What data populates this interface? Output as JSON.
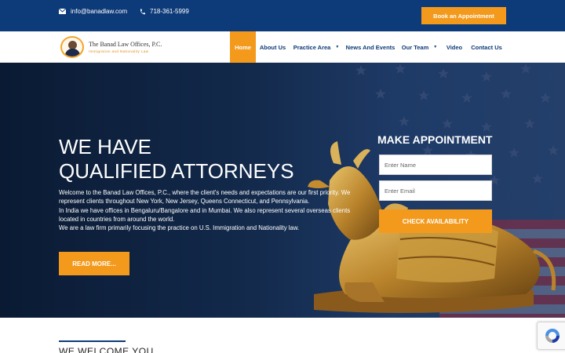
{
  "topbar": {
    "email": "info@banadlaw.com",
    "phone": "718-361-5999",
    "book_label": "Book an Appointment",
    "email_icon": "envelope-icon",
    "phone_icon": "phone-icon"
  },
  "logo": {
    "title": "The Banad Law Offices, P.C.",
    "subtitle": "Immigration and Nationality Law"
  },
  "nav": {
    "items": [
      {
        "label": "Home",
        "active": true
      },
      {
        "label": "About Us"
      },
      {
        "label": "Practice Area",
        "dropdown": true
      },
      {
        "label": "News And Events"
      },
      {
        "label": "Our Team",
        "dropdown": true
      },
      {
        "label": "Video"
      },
      {
        "label": "Contact Us"
      }
    ]
  },
  "hero": {
    "title_line1": "WE HAVE",
    "title_line2": "QUALIFIED ATTORNEYS",
    "para1": "Welcome to the Banad Law Offices, P.C., where the client's needs and expectations are our first priority. We represent clients throughout New York, New Jersey, Queens Connecticut, and Pennsylvania.",
    "para2": "In India we have offices in Bengaluru/Bangalore and in Mumbai. We also represent several overseas clients located in countries from around the world.",
    "para3": "We are a law firm primarily focusing the practice on U.S. Immigration and Nationality law.",
    "read_more_label": "READ MORE..."
  },
  "appointment": {
    "title": "MAKE APPOINTMENT",
    "name_placeholder": "Enter Name",
    "email_placeholder": "Enter Email",
    "check_label": "CHECK AVAILABILITY"
  },
  "welcome": {
    "title": "WE WELCOME YOU"
  },
  "colors": {
    "primary": "#0d3a78",
    "accent": "#f39a1d"
  }
}
